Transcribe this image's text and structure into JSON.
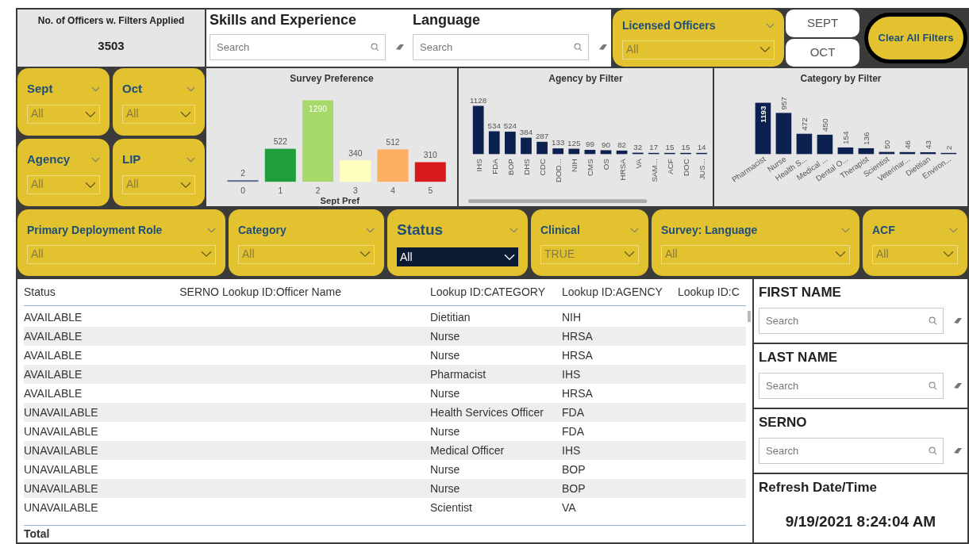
{
  "officer_count": {
    "label": "No. of Officers w. Filters Applied",
    "value": "3503"
  },
  "top_searches": [
    {
      "title": "Skills and Experience",
      "placeholder": "Search"
    },
    {
      "title": "Language",
      "placeholder": "Search"
    }
  ],
  "licensed_slicer": {
    "title": "Licensed Officers",
    "value": "All"
  },
  "month_buttons": [
    "SEPT",
    "OCT"
  ],
  "clear_button": "Clear All Filters",
  "side_slicers": [
    {
      "title": "Sept",
      "value": "All"
    },
    {
      "title": "Oct",
      "value": "All"
    },
    {
      "title": "Agency",
      "value": "All"
    },
    {
      "title": "LIP",
      "value": "All"
    }
  ],
  "charts": [
    {
      "title": "Survey Preference",
      "chart_data": {
        "type": "bar",
        "xlabel": "Sept Pref",
        "categories": [
          "0",
          "1",
          "2",
          "3",
          "4",
          "5"
        ],
        "stacked": true,
        "series": [
          {
            "color": "#5b6f8f",
            "values": [
              2,
              null,
              null,
              null,
              null,
              null
            ]
          },
          {
            "color": "#1f9e3b",
            "values": [
              null,
              522,
              null,
              null,
              null,
              null
            ]
          },
          {
            "color": "#a6d96a",
            "values": [
              null,
              null,
              1290,
              null,
              null,
              null
            ]
          },
          {
            "color": "#ffffbf",
            "values": [
              null,
              null,
              null,
              340,
              null,
              null
            ]
          },
          {
            "color": "#fdae61",
            "values": [
              null,
              null,
              null,
              null,
              512,
              null
            ]
          },
          {
            "color": "#d7191c",
            "values": [
              null,
              null,
              null,
              null,
              null,
              310
            ]
          }
        ],
        "data_labels": true
      }
    },
    {
      "title": "Agency by Filter",
      "chart_data": {
        "type": "bar",
        "categories": [
          "IHS",
          "FDA",
          "BOP",
          "DHS",
          "CDC",
          "DOD...",
          "NIH",
          "CMS",
          "OS",
          "HRSA",
          "VA",
          "SAM...",
          "ACF",
          "DOC",
          "JUS..."
        ],
        "series": [
          {
            "color": "#0d2150",
            "values": [
              1128,
              534,
              524,
              384,
              287,
              133,
              125,
              99,
              90,
              82,
              32,
              17,
              15,
              15,
              14
            ]
          }
        ],
        "data_labels": true
      }
    },
    {
      "title": "Category by Filter",
      "chart_data": {
        "type": "bar",
        "categories": [
          "Pharmacist",
          "Nurse",
          "Health S...",
          "Medical ...",
          "Dental O...",
          "Therapist",
          "Scientist",
          "Veterinar...",
          "Dietitian",
          "Environ..."
        ],
        "series": [
          {
            "color": "#0d2150",
            "values": [
              1193,
              957,
              472,
              450,
              154,
              136,
              50,
              46,
              43,
              2
            ]
          }
        ],
        "data_labels": true
      }
    }
  ],
  "filter_slicers": [
    {
      "title": "Primary Deployment Role",
      "value": "All",
      "kind": "plain"
    },
    {
      "title": "Category",
      "value": "All",
      "kind": "plain"
    },
    {
      "title": "Status",
      "value": "All",
      "kind": "dark"
    },
    {
      "title": "Clinical",
      "value": "TRUE",
      "kind": "plain"
    },
    {
      "title": "Survey: Language",
      "value": "All",
      "kind": "plain"
    },
    {
      "title": "ACF",
      "value": "All",
      "kind": "plain"
    }
  ],
  "table": {
    "columns": [
      "Status",
      "SERNO",
      "Lookup ID:Officer Name",
      "Lookup ID:CATEGORY",
      "Lookup ID:AGENCY",
      "Lookup ID:C"
    ],
    "rows": [
      [
        "AVAILABLE",
        "Dietitian",
        "NIH"
      ],
      [
        "AVAILABLE",
        "Nurse",
        "HRSA"
      ],
      [
        "AVAILABLE",
        "Nurse",
        "HRSA"
      ],
      [
        "AVAILABLE",
        "Pharmacist",
        "IHS"
      ],
      [
        "AVAILABLE",
        "Nurse",
        "HRSA"
      ],
      [
        "UNAVAILABLE",
        "Health Services Officer",
        "FDA"
      ],
      [
        "UNAVAILABLE",
        "Nurse",
        "FDA"
      ],
      [
        "UNAVAILABLE",
        "Medical Officer",
        "IHS"
      ],
      [
        "UNAVAILABLE",
        "Nurse",
        "BOP"
      ],
      [
        "UNAVAILABLE",
        "Nurse",
        "BOP"
      ],
      [
        "UNAVAILABLE",
        "Scientist",
        "VA"
      ]
    ],
    "total": "Total"
  },
  "name_searches": [
    {
      "title": "FIRST NAME",
      "placeholder": "Search"
    },
    {
      "title": "LAST NAME",
      "placeholder": "Search"
    },
    {
      "title": "SERNO",
      "placeholder": "Search"
    }
  ],
  "refresh": {
    "title": "Refresh Date/Time",
    "value": "9/19/2021 8:24:04 AM"
  }
}
